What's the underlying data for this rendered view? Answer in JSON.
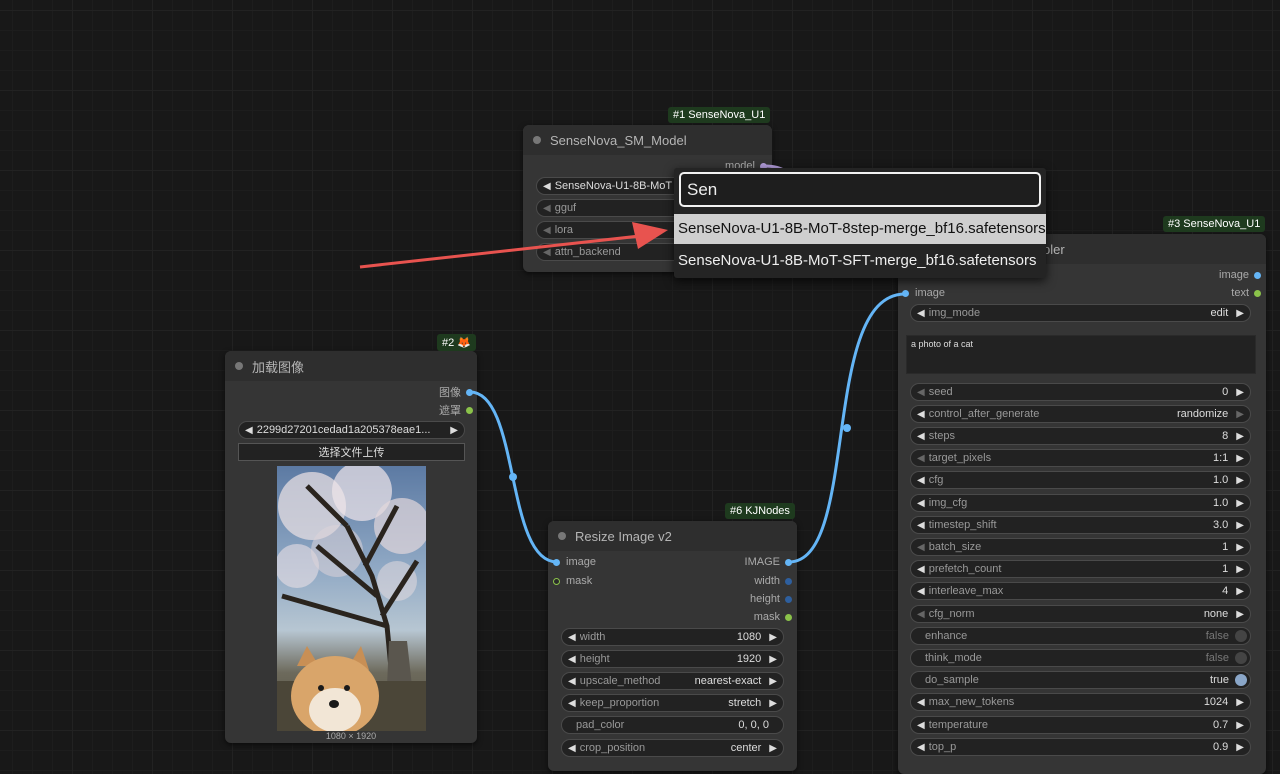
{
  "node1": {
    "badge": "#1 SenseNova_U1",
    "title": "SenseNova_SM_Model",
    "output": "model",
    "widgets": [
      {
        "label": "SenseNova-U1-8B-MoT"
      },
      {
        "label": "gguf"
      },
      {
        "label": "lora"
      },
      {
        "label": "attn_backend"
      }
    ]
  },
  "search": {
    "query": "Sen",
    "options": [
      "SenseNova-U1-8B-MoT-8step-merge_bf16.safetensors",
      "SenseNova-U1-8B-MoT-SFT-merge_bf16.safetensors"
    ]
  },
  "node2": {
    "badge": "#2",
    "badge_icon": "fox-icon",
    "title": "加载图像",
    "outputs": [
      "图像",
      "遮罩"
    ],
    "file": "2299d27201cedad1a205378eae1...",
    "upload": "选择文件上传",
    "image_size": "1080 × 1920"
  },
  "node6": {
    "badge": "#6 KJNodes",
    "title": "Resize Image v2",
    "inputs": [
      "image",
      "mask"
    ],
    "outputs": [
      "IMAGE",
      "width",
      "height",
      "mask"
    ],
    "widgets": [
      {
        "label": "width",
        "value": "1080"
      },
      {
        "label": "height",
        "value": "1920"
      },
      {
        "label": "upscale_method",
        "value": "nearest-exact"
      },
      {
        "label": "keep_proportion",
        "value": "stretch"
      },
      {
        "label": "pad_color",
        "value": "0, 0, 0"
      },
      {
        "label": "crop_position",
        "value": "center"
      }
    ]
  },
  "node3": {
    "badge": "#3 SenseNova_U1",
    "title_fragment": "pler",
    "outputs": [
      "image",
      "text"
    ],
    "input": "image",
    "prompt": "a photo of a cat",
    "widgets": [
      {
        "label": "img_mode",
        "value": "edit"
      },
      {
        "label": "seed",
        "value": "0"
      },
      {
        "label": "control_after_generate",
        "value": "randomize"
      },
      {
        "label": "steps",
        "value": "8"
      },
      {
        "label": "target_pixels",
        "value": "1:1"
      },
      {
        "label": "cfg",
        "value": "1.0"
      },
      {
        "label": "img_cfg",
        "value": "1.0"
      },
      {
        "label": "timestep_shift",
        "value": "3.0"
      },
      {
        "label": "batch_size",
        "value": "1"
      },
      {
        "label": "prefetch_count",
        "value": "1"
      },
      {
        "label": "interleave_max",
        "value": "4"
      },
      {
        "label": "cfg_norm",
        "value": "none"
      },
      {
        "label": "enhance",
        "value": "false"
      },
      {
        "label": "think_mode",
        "value": "false"
      },
      {
        "label": "do_sample",
        "value": "true"
      },
      {
        "label": "max_new_tokens",
        "value": "1024"
      },
      {
        "label": "temperature",
        "value": "0.7"
      },
      {
        "label": "top_p",
        "value": "0.9"
      }
    ]
  },
  "colors": {
    "canvas": "#181818",
    "node": "#353535",
    "wire_image": "#64b5f6",
    "arrow": "#e8534f",
    "badge": "#1e3a1e"
  }
}
